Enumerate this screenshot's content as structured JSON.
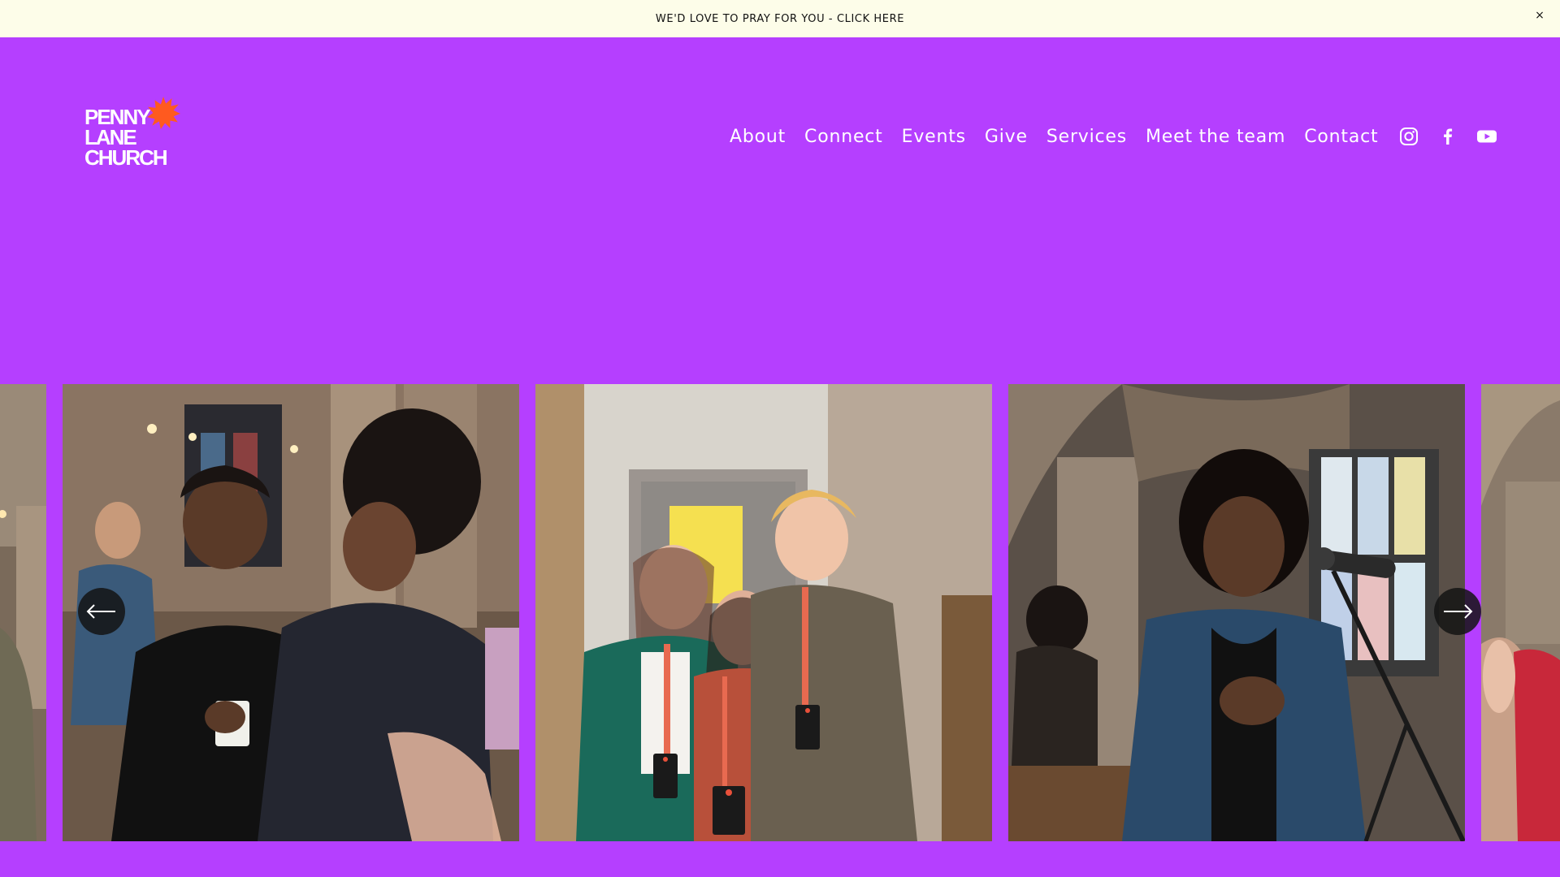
{
  "announcement": {
    "text": "WE'D LOVE TO PRAY FOR YOU - CLICK HERE",
    "close": "×"
  },
  "logo": {
    "text": "PENNY\nLANE\nCHURCH",
    "splat_color": "#ff5a1f"
  },
  "nav": {
    "items": [
      {
        "label": "About"
      },
      {
        "label": "Connect"
      },
      {
        "label": "Events"
      },
      {
        "label": "Give"
      },
      {
        "label": "Services"
      },
      {
        "label": "Meet the team"
      },
      {
        "label": "Contact"
      }
    ]
  },
  "social": {
    "icons": [
      "instagram-icon",
      "facebook-icon",
      "youtube-icon"
    ]
  },
  "gallery": {
    "slides": [
      {
        "subject": "partial-left"
      },
      {
        "subject": "two-men-laughing"
      },
      {
        "subject": "three-team-members"
      },
      {
        "subject": "woman-singing"
      },
      {
        "subject": "partial-right"
      }
    ],
    "prev_icon": "arrow-left-icon",
    "next_icon": "arrow-right-icon"
  },
  "colors": {
    "background": "#b53fff",
    "announcement_bg": "#fdfde9",
    "text_light": "#ffffff",
    "accent": "#ff5a1f"
  }
}
